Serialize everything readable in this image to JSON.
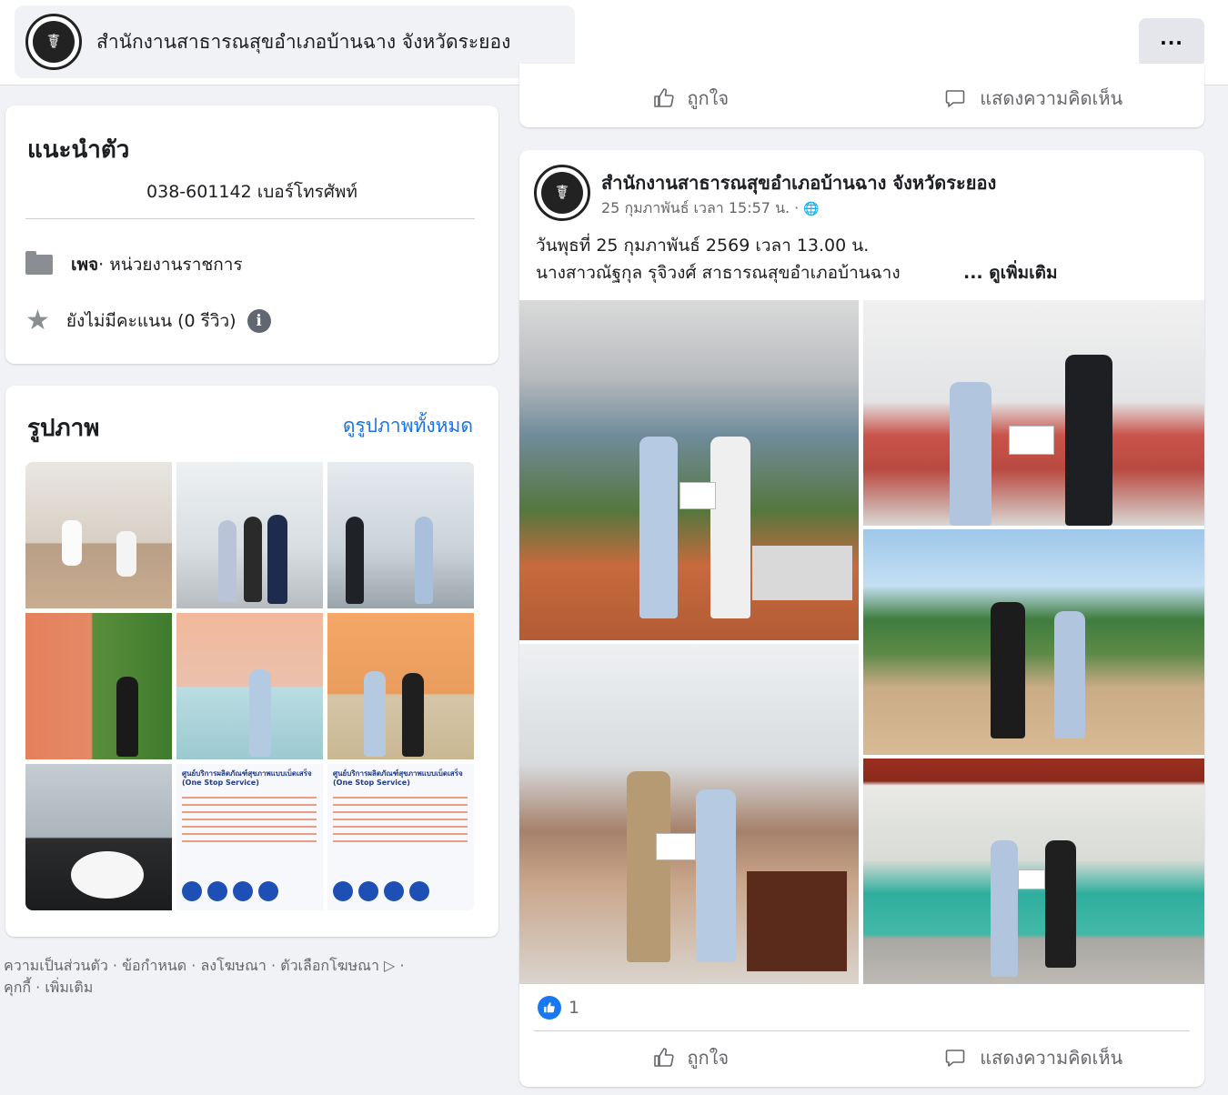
{
  "header": {
    "page_name": "สำนักงานสาธารณสุขอำเภอบ้านฉาง จังหวัดระยอง",
    "more_label": "···"
  },
  "intro": {
    "title": "แนะนำตัว",
    "phone": "038-601142 เบอร์โทรศัพท์",
    "category_prefix": "เพจ",
    "category": " · หน่วยงานราชการ",
    "rating": "ยังไม่มีคะแนน (0 รีวิว)",
    "icons": [
      "folder-icon",
      "star-icon",
      "info-icon"
    ]
  },
  "photos": {
    "title": "รูปภาพ",
    "see_all": "ดูรูปภาพทั้งหมด",
    "poster_heading": "ศูนย์บริการผลิตภัณฑ์สุขภาพแบบเบ็ดเสร็จ (One Stop Service)"
  },
  "footer": {
    "links": "ความเป็นส่วนตัว · ข้อกำหนด · ลงโฆษณา · ตัวเลือกโฆษณา ▷ ·",
    "links2": "คุกกี้ · เพิ่มเติม"
  },
  "actions": {
    "like": "ถูกใจ",
    "comment": "แสดงความคิดเห็น"
  },
  "post": {
    "author": "สำนักงานสาธารณสุขอำเภอบ้านฉาง จังหวัดระยอง",
    "meta": "25 กุมภาพันธ์ เวลา 15:57 น. · ",
    "globe": "🌐",
    "line1": "วันพุธที่ 25 กุมภาพันธ์ 2569 เวลา 13.00 น.",
    "line2": "นางสาวณัฐกุล รุจิวงศ์ สาธารณสุขอำเภอบ้านฉาง",
    "see_more": "... ดูเพิ่มเติม",
    "reaction_count": "1"
  },
  "colors": {
    "accent": "#1b74e4",
    "like_blue": "#1877f2",
    "muted": "#65676b",
    "background": "#f0f2f5"
  }
}
